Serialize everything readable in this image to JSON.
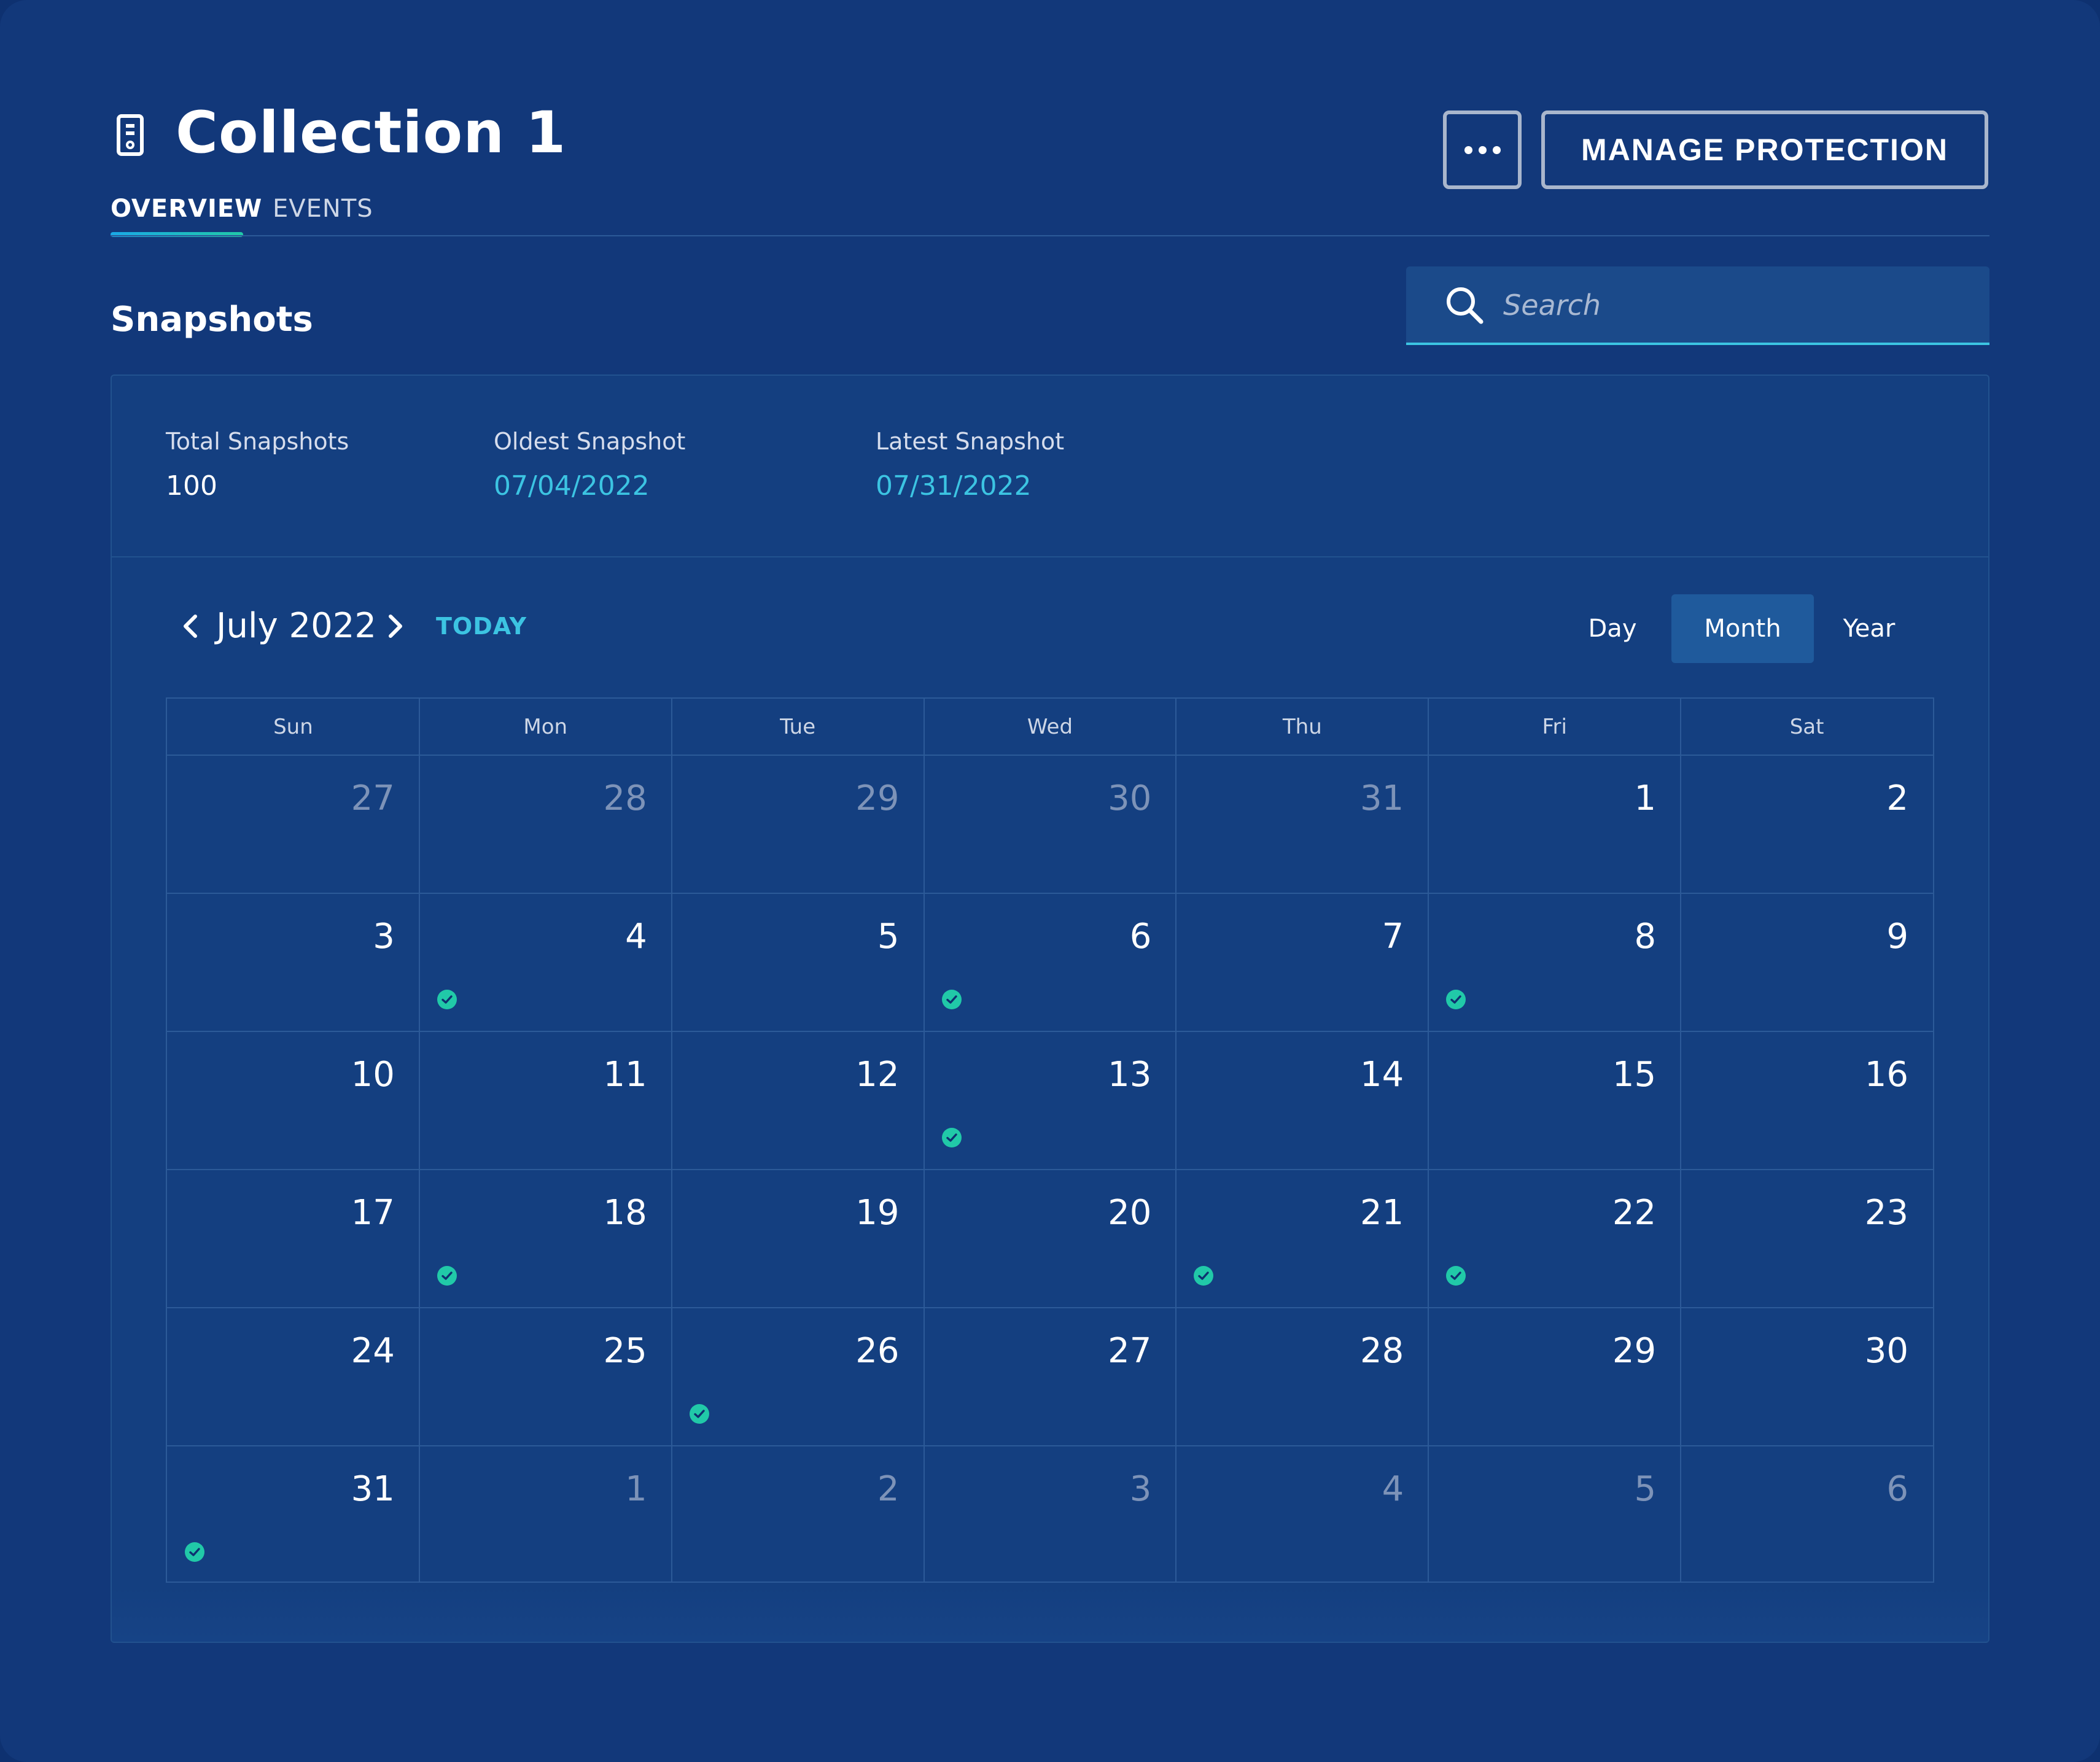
{
  "header": {
    "title": "Collection 1",
    "app_icon": "server-icon",
    "more_icon": "more-horizontal-icon",
    "manage_label": "MANAGE PROTECTION"
  },
  "tabs": [
    {
      "label": "OVERVIEW",
      "active": true
    },
    {
      "label": "EVENTS",
      "active": false
    }
  ],
  "section": {
    "title": "Snapshots"
  },
  "search": {
    "placeholder": "Search",
    "value": "",
    "icon": "search-icon"
  },
  "stats": [
    {
      "label": "Total Snapshots",
      "value": "100",
      "style": "plain"
    },
    {
      "label": "Oldest Snapshot",
      "value": "07/04/2022",
      "style": "link"
    },
    {
      "label": "Latest Snapshot",
      "value": "07/31/2022",
      "style": "link"
    }
  ],
  "calendar": {
    "month_label": "July 2022",
    "today_label": "TODAY",
    "views": [
      {
        "label": "Day",
        "active": false
      },
      {
        "label": "Month",
        "active": true
      },
      {
        "label": "Year",
        "active": false
      }
    ],
    "weekdays": [
      "Sun",
      "Mon",
      "Tue",
      "Wed",
      "Thu",
      "Fri",
      "Sat"
    ],
    "weeks": [
      [
        {
          "day": "27",
          "current": false
        },
        {
          "day": "28",
          "current": false
        },
        {
          "day": "29",
          "current": false
        },
        {
          "day": "30",
          "current": false
        },
        {
          "day": "31",
          "current": false
        },
        {
          "day": "1",
          "current": true
        },
        {
          "day": "2",
          "current": true
        }
      ],
      [
        {
          "day": "3",
          "current": true
        },
        {
          "day": "4",
          "current": true,
          "snapshot": true
        },
        {
          "day": "5",
          "current": true
        },
        {
          "day": "6",
          "current": true,
          "snapshot": true
        },
        {
          "day": "7",
          "current": true
        },
        {
          "day": "8",
          "current": true,
          "snapshot": true
        },
        {
          "day": "9",
          "current": true
        }
      ],
      [
        {
          "day": "10",
          "current": true
        },
        {
          "day": "11",
          "current": true
        },
        {
          "day": "12",
          "current": true
        },
        {
          "day": "13",
          "current": true,
          "snapshot": true
        },
        {
          "day": "14",
          "current": true
        },
        {
          "day": "15",
          "current": true
        },
        {
          "day": "16",
          "current": true
        }
      ],
      [
        {
          "day": "17",
          "current": true
        },
        {
          "day": "18",
          "current": true,
          "snapshot": true
        },
        {
          "day": "19",
          "current": true
        },
        {
          "day": "20",
          "current": true
        },
        {
          "day": "21",
          "current": true,
          "snapshot": true
        },
        {
          "day": "22",
          "current": true,
          "snapshot": true
        },
        {
          "day": "23",
          "current": true
        }
      ],
      [
        {
          "day": "24",
          "current": true
        },
        {
          "day": "25",
          "current": true
        },
        {
          "day": "26",
          "current": true,
          "snapshot": true
        },
        {
          "day": "27",
          "current": true
        },
        {
          "day": "28",
          "current": true
        },
        {
          "day": "29",
          "current": true
        },
        {
          "day": "30",
          "current": true
        }
      ],
      [
        {
          "day": "31",
          "current": true,
          "snapshot": true
        },
        {
          "day": "1",
          "current": false
        },
        {
          "day": "2",
          "current": false
        },
        {
          "day": "3",
          "current": false
        },
        {
          "day": "4",
          "current": false
        },
        {
          "day": "5",
          "current": false
        },
        {
          "day": "6",
          "current": false
        }
      ]
    ],
    "snapshot_icon": "check-circle-icon"
  },
  "colors": {
    "background": "#12387a",
    "panel": "#143f80",
    "accent": "#3cc4e2",
    "snapshot_marker": "#21c9a8"
  }
}
